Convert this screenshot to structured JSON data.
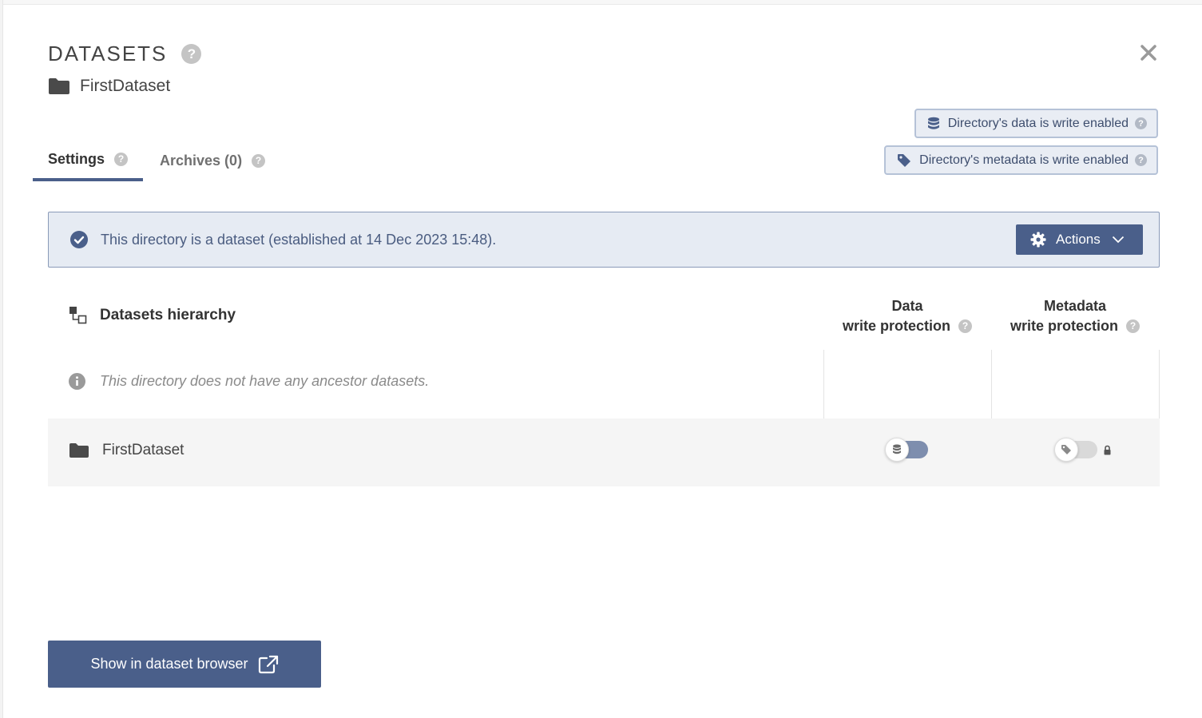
{
  "header": {
    "title": "DATASETS",
    "help": "?",
    "subtitle": "FirstDataset"
  },
  "tabs": [
    {
      "label": "Settings",
      "help": "?"
    },
    {
      "label": "Archives (0)",
      "help": "?"
    }
  ],
  "badges": {
    "data_label": "Directory's data is write enabled",
    "metadata_label": "Directory's metadata is write enabled",
    "help": "?"
  },
  "alert": {
    "text": "This directory is a dataset (established at 14 Dec 2023 15:48).",
    "actions_label": "Actions"
  },
  "hierarchy": {
    "title": "Datasets hierarchy",
    "col_data_line1": "Data",
    "col_data_line2": "write protection",
    "col_meta_line1": "Metadata",
    "col_meta_line2": "write protection",
    "help": "?",
    "info_text": "This directory does not have any ancestor datasets.",
    "row": {
      "name": "FirstDataset",
      "data_protection": false,
      "metadata_protection": false,
      "metadata_locked": true
    }
  },
  "footer": {
    "browse_label": "Show in dataset browser"
  },
  "colors": {
    "accent": "#4a5f8a",
    "alert_bg": "#e6ebf3",
    "badge_bg": "#e9edf4"
  }
}
